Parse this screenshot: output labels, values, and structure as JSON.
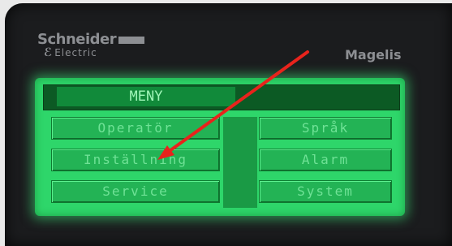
{
  "device": {
    "brand": "Schneider",
    "brand_sub": "Electric",
    "model": "Magelis"
  },
  "screen": {
    "title": "MENY",
    "left_buttons": [
      "Operatör",
      "Inställning",
      "Service"
    ],
    "right_buttons": [
      "Språk",
      "Alarm",
      "System"
    ]
  },
  "annotation": {
    "arrow_color": "#e8231c",
    "icon": "red-arrow-icon"
  },
  "colors": {
    "screen_green": "#2ed66a",
    "button_green": "#23b355",
    "title_bar": "#0c5a24"
  }
}
